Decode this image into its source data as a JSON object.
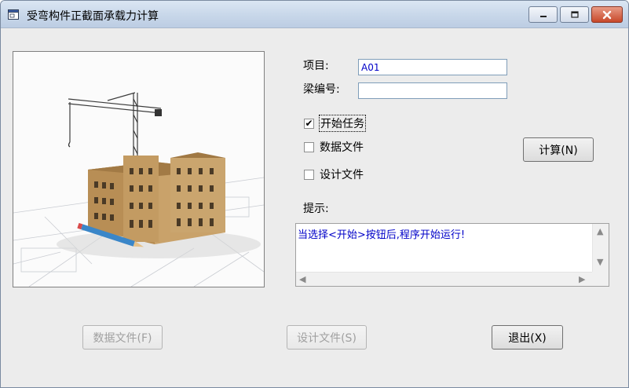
{
  "window": {
    "title": "受弯构件正截面承载力计算",
    "controls": {
      "minimize": "minimize",
      "maximize": "maximize",
      "close": "close"
    }
  },
  "form": {
    "project_label": "项目:",
    "project_value": "A01",
    "beam_label": "梁编号:",
    "beam_value": ""
  },
  "options": [
    {
      "label": "开始任务",
      "checked": true
    },
    {
      "label": "数据文件",
      "checked": false
    },
    {
      "label": "设计文件",
      "checked": false
    }
  ],
  "hint": {
    "label": "提示:",
    "text": "当选择<开始>按钮后,程序开始运行!"
  },
  "buttons": {
    "calculate": "计算(N)",
    "data_file": "数据文件(F)",
    "design_file": "设计文件(S)",
    "exit": "退出(X)"
  },
  "picture": {
    "description_icon": "building-construction-image"
  }
}
